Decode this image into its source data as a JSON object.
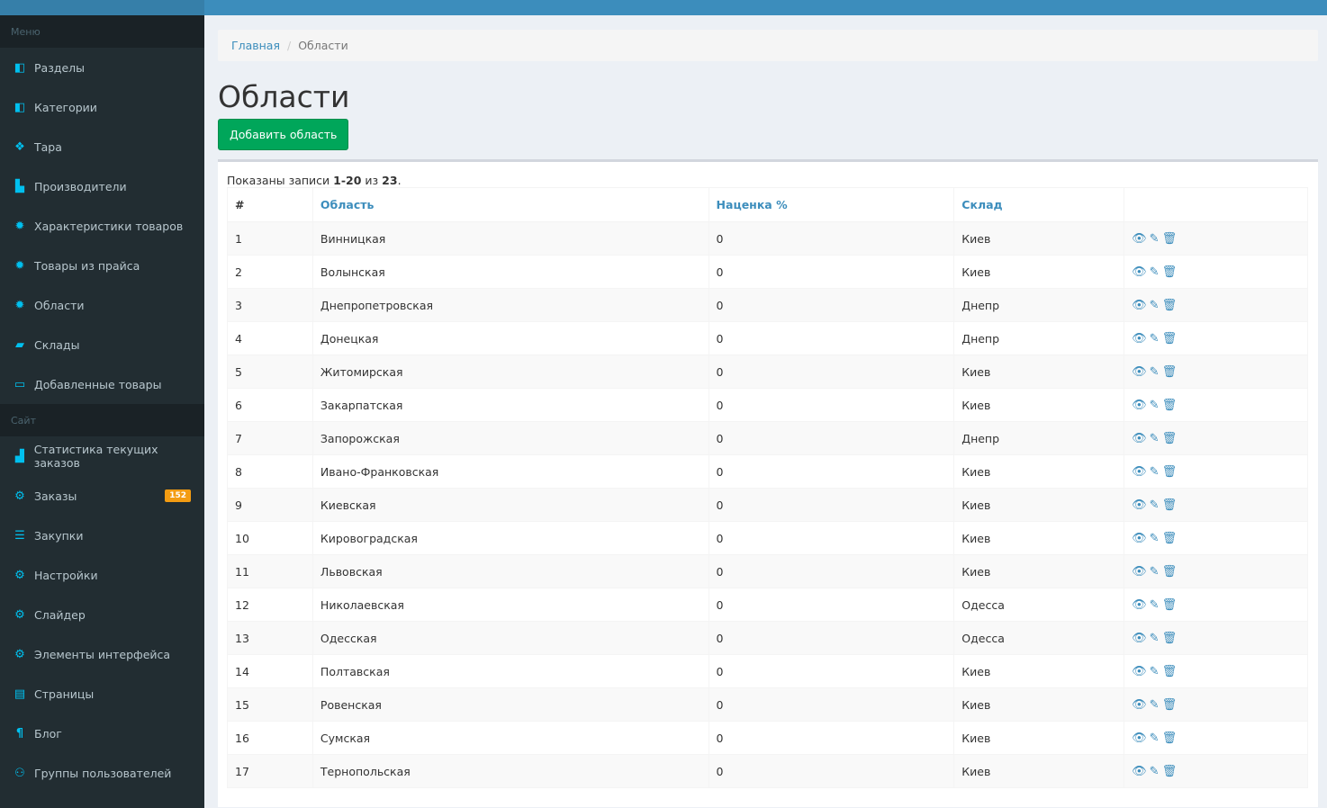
{
  "sidebar": {
    "menu_header": "Меню",
    "menu_items": [
      {
        "label": "Разделы",
        "icon": "share-square-icon"
      },
      {
        "label": "Категории",
        "icon": "share-square-icon"
      },
      {
        "label": "Тара",
        "icon": "dropbox-icon"
      },
      {
        "label": "Производители",
        "icon": "industry-icon"
      },
      {
        "label": "Характеристики товаров",
        "icon": "gear-icon"
      },
      {
        "label": "Товары из прайса",
        "icon": "gear-icon"
      },
      {
        "label": "Области",
        "icon": "gear-icon"
      },
      {
        "label": "Склады",
        "icon": "truck-icon"
      },
      {
        "label": "Добавленные товары",
        "icon": "inbox-icon"
      }
    ],
    "site_header": "Сайт",
    "site_items": [
      {
        "label": "Статистика текущих заказов",
        "icon": "bar-chart-icon"
      },
      {
        "label": "Заказы",
        "icon": "gears-icon",
        "badge": "152"
      },
      {
        "label": "Закупки",
        "icon": "list-icon"
      },
      {
        "label": "Настройки",
        "icon": "gears-icon"
      },
      {
        "label": "Слайдер",
        "icon": "gears-icon"
      },
      {
        "label": "Элементы интерфейса",
        "icon": "gears-icon"
      },
      {
        "label": "Страницы",
        "icon": "file-icon"
      },
      {
        "label": "Блог",
        "icon": "paragraph-icon"
      },
      {
        "label": "Группы пользователей",
        "icon": "users-icon"
      }
    ]
  },
  "breadcrumb": {
    "home": "Главная",
    "current": "Области"
  },
  "page_title": "Области",
  "add_button": "Добавить область",
  "summary": {
    "prefix": "Показаны записи ",
    "range": "1-20",
    "middle": " из ",
    "total": "23",
    "suffix": "."
  },
  "table": {
    "headers": [
      "#",
      "Область",
      "Наценка %",
      "Склад",
      ""
    ],
    "rows": [
      [
        "1",
        "Винницкая",
        "0",
        "Киев"
      ],
      [
        "2",
        "Волынская",
        "0",
        "Киев"
      ],
      [
        "3",
        "Днепропетровская",
        "0",
        "Днепр"
      ],
      [
        "4",
        "Донецкая",
        "0",
        "Днепр"
      ],
      [
        "5",
        "Житомирская",
        "0",
        "Киев"
      ],
      [
        "6",
        "Закарпатская",
        "0",
        "Киев"
      ],
      [
        "7",
        "Запорожская",
        "0",
        "Днепр"
      ],
      [
        "8",
        "Ивано-Франковская",
        "0",
        "Киев"
      ],
      [
        "9",
        "Киевская",
        "0",
        "Киев"
      ],
      [
        "10",
        "Кировоградская",
        "0",
        "Киев"
      ],
      [
        "11",
        "Львовская",
        "0",
        "Киев"
      ],
      [
        "12",
        "Николаевская",
        "0",
        "Одесса"
      ],
      [
        "13",
        "Одесская",
        "0",
        "Одесса"
      ],
      [
        "14",
        "Полтавская",
        "0",
        "Киев"
      ],
      [
        "15",
        "Ровенская",
        "0",
        "Киев"
      ],
      [
        "16",
        "Сумская",
        "0",
        "Киев"
      ],
      [
        "17",
        "Тернопольская",
        "0",
        "Киев"
      ]
    ]
  },
  "colors": {
    "topbar": "#3c8dbc",
    "sidebar": "#222d32",
    "accent_icon": "#00c0ef",
    "add_button": "#00a65a",
    "badge": "#f39c12",
    "link": "#3c8dbc"
  }
}
